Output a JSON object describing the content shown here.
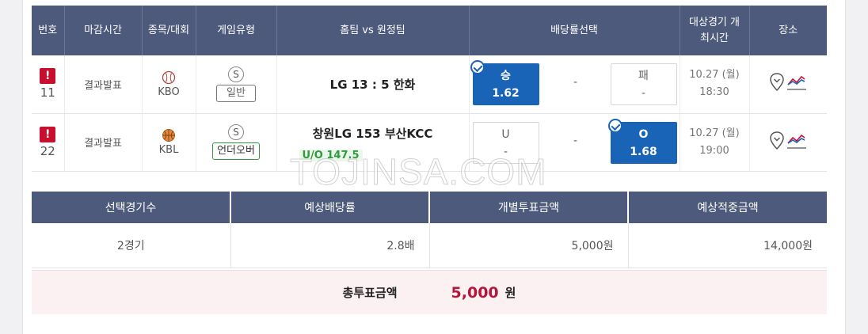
{
  "game_headers": [
    "번호",
    "마감시간",
    "종목/대회",
    "게임유형",
    "홈팀 vs 원정팀",
    "배당률선택",
    "대상경기 개최시간",
    "장소"
  ],
  "games": [
    {
      "warn": "!",
      "no": "11",
      "status": "결과발표",
      "league": "KBO",
      "sport_icon": "baseball-icon",
      "type_symbol": "S",
      "type": "일반",
      "match": "LG 13 : 5 한화",
      "uo_line": "",
      "odd_left_top": "승",
      "odd_left_bottom": "1.62",
      "odd_mid": "-",
      "odd_right_top": "패",
      "odd_right_bottom": "-",
      "date": "10.27 (월)",
      "time": "18:30"
    },
    {
      "warn": "!",
      "no": "22",
      "status": "결과발표",
      "league": "KBL",
      "sport_icon": "basketball-icon",
      "type_symbol": "S",
      "type": "언더오버",
      "match": "창원LG  153  부산KCC",
      "uo_line": "U/O 147.5",
      "odd_left_top": "U",
      "odd_left_bottom": "-",
      "odd_mid": "-",
      "odd_right_top": "O",
      "odd_right_bottom": "1.68",
      "date": "10.27 (월)",
      "time": "19:00"
    }
  ],
  "summary_headers": [
    "선택경기수",
    "예상배당률",
    "개별투표금액",
    "예상적중금액"
  ],
  "summary_values": [
    "2경기",
    "2.8배",
    "5,000원",
    "14,000원"
  ],
  "total": {
    "label": "총투표금액",
    "amount": "5,000",
    "unit": "원"
  },
  "watermark": "TOJINSA.COM",
  "colors": {
    "header_bg": "#4e5a7c",
    "selected": "#1a64b8",
    "accent_red": "#b5153b",
    "green": "#2e9b3c"
  }
}
